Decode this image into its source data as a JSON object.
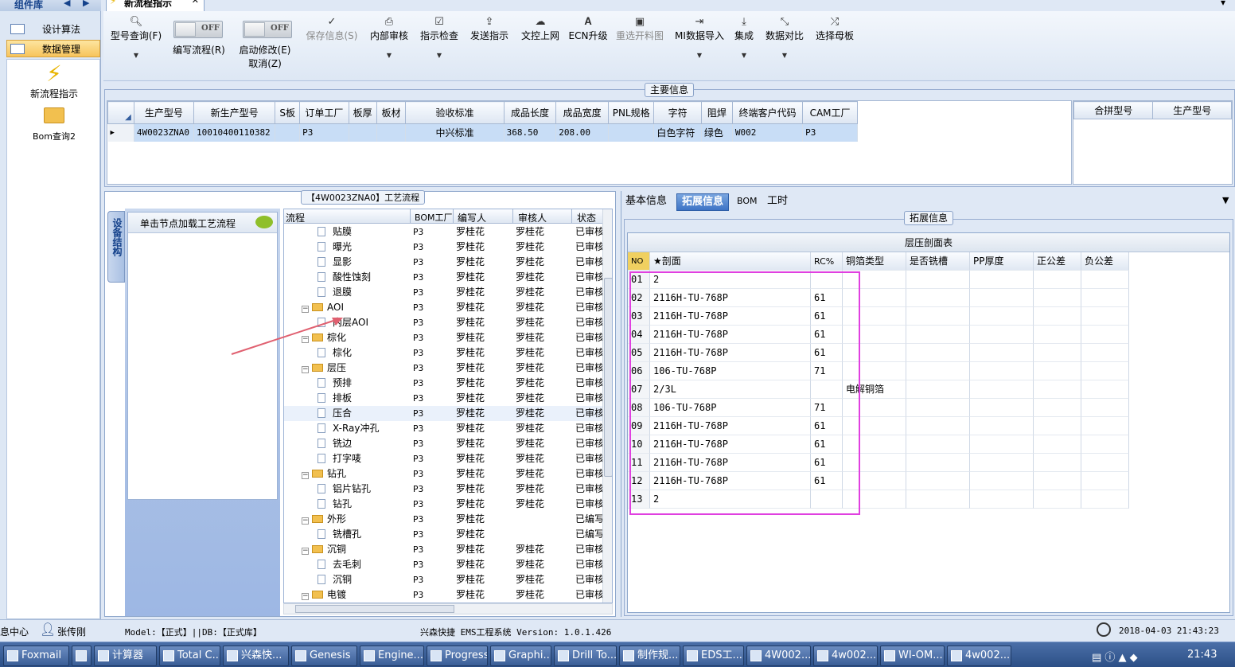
{
  "sidebar": {
    "title": "组件库",
    "items": [
      {
        "label": "设计算法"
      },
      {
        "label": "数据管理"
      }
    ],
    "icons": [
      {
        "label": "新流程指示"
      },
      {
        "label": "Bom查询2"
      }
    ]
  },
  "tab": {
    "label": "新流程指示"
  },
  "toolbar": {
    "model_query": "型号查询(F)",
    "edit_flow": "编写流程(R)",
    "toggle_off": "OFF",
    "enable_edit": "启动修改(E)",
    "cancel": "取消(Z)",
    "save_info": "保存信息(S)",
    "internal_review": "内部审核",
    "instruction_check": "指示检查",
    "send_instruction": "发送指示",
    "upload": "文控上网",
    "ecn": "ECN升级",
    "reselect": "重选开料图",
    "mi_import": "MI数据导入",
    "integrate": "集成",
    "compare": "数据对比",
    "select_master": "选择母板"
  },
  "main_info": {
    "title": "主要信息",
    "headers": [
      "生产型号",
      "新生产型号",
      "S板",
      "订单工厂",
      "板厚",
      "板材",
      "验收标准",
      "成品长度",
      "成品宽度",
      "PNL规格",
      "字符",
      "阻焊",
      "终端客户代码",
      "CAM工厂"
    ],
    "row": [
      "4W0023ZNA0",
      "10010400110382",
      "",
      "P3",
      "",
      "",
      "中兴标准",
      "368.50",
      "208.00",
      "",
      "白色字符",
      "绿色",
      "W002",
      "P3"
    ],
    "merge_headers": [
      "合拼型号",
      "生产型号"
    ]
  },
  "flow": {
    "title": "【4W0023ZNA0】工艺流程",
    "side_tab": "设备结构",
    "load_hint": "单击节点加载工艺流程",
    "headers": [
      "流程",
      "BOM工厂",
      "编写人",
      "审核人",
      "状态"
    ],
    "rows": [
      {
        "level": 2,
        "name": "贴膜",
        "f": "P3",
        "w": "罗桂花",
        "r": "罗桂花",
        "s": "已审核"
      },
      {
        "level": 2,
        "name": "曝光",
        "f": "P3",
        "w": "罗桂花",
        "r": "罗桂花",
        "s": "已审核"
      },
      {
        "level": 2,
        "name": "显影",
        "f": "P3",
        "w": "罗桂花",
        "r": "罗桂花",
        "s": "已审核"
      },
      {
        "level": 2,
        "name": "酸性蚀刻",
        "f": "P3",
        "w": "罗桂花",
        "r": "罗桂花",
        "s": "已审核"
      },
      {
        "level": 2,
        "name": "退膜",
        "f": "P3",
        "w": "罗桂花",
        "r": "罗桂花",
        "s": "已审核"
      },
      {
        "level": 1,
        "name": "AOI",
        "f": "P3",
        "w": "罗桂花",
        "r": "罗桂花",
        "s": "已审核"
      },
      {
        "level": 2,
        "name": "内层AOI",
        "f": "P3",
        "w": "罗桂花",
        "r": "罗桂花",
        "s": "已审核"
      },
      {
        "level": 1,
        "name": "棕化",
        "f": "P3",
        "w": "罗桂花",
        "r": "罗桂花",
        "s": "已审核"
      },
      {
        "level": 2,
        "name": "棕化",
        "f": "P3",
        "w": "罗桂花",
        "r": "罗桂花",
        "s": "已审核"
      },
      {
        "level": 1,
        "name": "层压",
        "f": "P3",
        "w": "罗桂花",
        "r": "罗桂花",
        "s": "已审核"
      },
      {
        "level": 2,
        "name": "预排",
        "f": "P3",
        "w": "罗桂花",
        "r": "罗桂花",
        "s": "已审核"
      },
      {
        "level": 2,
        "name": "排板",
        "f": "P3",
        "w": "罗桂花",
        "r": "罗桂花",
        "s": "已审核"
      },
      {
        "level": 2,
        "name": "压合",
        "f": "P3",
        "w": "罗桂花",
        "r": "罗桂花",
        "s": "已审核"
      },
      {
        "level": 2,
        "name": "X-Ray冲孔",
        "f": "P3",
        "w": "罗桂花",
        "r": "罗桂花",
        "s": "已审核"
      },
      {
        "level": 2,
        "name": "铣边",
        "f": "P3",
        "w": "罗桂花",
        "r": "罗桂花",
        "s": "已审核"
      },
      {
        "level": 2,
        "name": "打字唛",
        "f": "P3",
        "w": "罗桂花",
        "r": "罗桂花",
        "s": "已审核"
      },
      {
        "level": 1,
        "name": "钻孔",
        "f": "P3",
        "w": "罗桂花",
        "r": "罗桂花",
        "s": "已审核"
      },
      {
        "level": 2,
        "name": "铝片钻孔",
        "f": "P3",
        "w": "罗桂花",
        "r": "罗桂花",
        "s": "已审核"
      },
      {
        "level": 2,
        "name": "钻孔",
        "f": "P3",
        "w": "罗桂花",
        "r": "罗桂花",
        "s": "已审核"
      },
      {
        "level": 1,
        "name": "外形",
        "f": "P3",
        "w": "罗桂花",
        "r": "",
        "s": "已编写"
      },
      {
        "level": 2,
        "name": "铣槽孔",
        "f": "P3",
        "w": "罗桂花",
        "r": "",
        "s": "已编写"
      },
      {
        "level": 1,
        "name": "沉铜",
        "f": "P3",
        "w": "罗桂花",
        "r": "罗桂花",
        "s": "已审核"
      },
      {
        "level": 2,
        "name": "去毛刺",
        "f": "P3",
        "w": "罗桂花",
        "r": "罗桂花",
        "s": "已审核"
      },
      {
        "level": 2,
        "name": "沉铜",
        "f": "P3",
        "w": "罗桂花",
        "r": "罗桂花",
        "s": "已审核"
      },
      {
        "level": 1,
        "name": "电镀",
        "f": "P3",
        "w": "罗桂花",
        "r": "罗桂花",
        "s": "已审核"
      }
    ]
  },
  "right": {
    "tabs": [
      "基本信息",
      "拓展信息",
      "BOM",
      "工时"
    ],
    "section_title": "拓展信息",
    "table_title": "层压剖面表",
    "headers": [
      "NO",
      "★剖面",
      "RC%",
      "铜箔类型",
      "是否铣槽",
      "PP厚度",
      "正公差",
      "负公差"
    ],
    "rows": [
      [
        "01",
        "2",
        "",
        ""
      ],
      [
        "02",
        "2116H-TU-768P",
        "61",
        ""
      ],
      [
        "03",
        "2116H-TU-768P",
        "61",
        ""
      ],
      [
        "04",
        "2116H-TU-768P",
        "61",
        ""
      ],
      [
        "05",
        "2116H-TU-768P",
        "61",
        ""
      ],
      [
        "06",
        "106-TU-768P",
        "71",
        ""
      ],
      [
        "07",
        "2/3L",
        "",
        "电解铜箔"
      ],
      [
        "08",
        "106-TU-768P",
        "71",
        ""
      ],
      [
        "09",
        "2116H-TU-768P",
        "61",
        ""
      ],
      [
        "10",
        "2116H-TU-768P",
        "61",
        ""
      ],
      [
        "11",
        "2116H-TU-768P",
        "61",
        ""
      ],
      [
        "12",
        "2116H-TU-768P",
        "61",
        ""
      ],
      [
        "13",
        "2",
        "",
        ""
      ]
    ]
  },
  "status": {
    "center": "息中心",
    "user": "张传刚",
    "model": "Model:【正式】||DB:【正式库】",
    "system": "兴森快捷 EMS工程系统 Version: 1.0.1.426",
    "datetime": "2018-04-03 21:43:23"
  },
  "taskbar": {
    "items": [
      "Foxmail",
      "",
      "计算器",
      "Total C...",
      "兴森快...",
      "Genesis",
      "Engine...",
      "Progress",
      "Graphi...",
      "Drill To...",
      "制作规...",
      "EDS工...",
      "4W002...",
      "4w002...",
      "WI-OM...",
      "4w002..."
    ],
    "clock": "21:43"
  },
  "colors": {
    "accent": "#15428b",
    "highlight_box": "#e040e0",
    "arrow": "#e06070",
    "selected_row": "#c8ddf6"
  }
}
